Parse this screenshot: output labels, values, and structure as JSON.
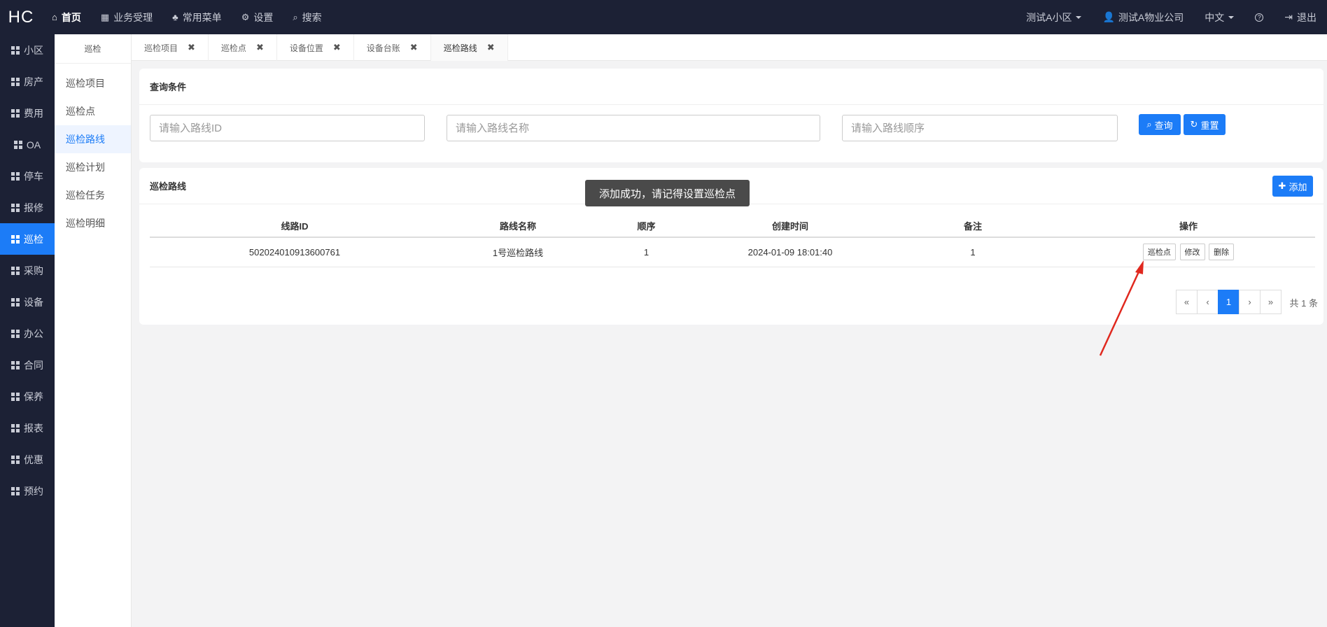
{
  "logo": "HC",
  "topnav": [
    {
      "icon": "home-icon",
      "label": "首页"
    },
    {
      "icon": "table-icon",
      "label": "业务受理"
    },
    {
      "icon": "sitemap-icon",
      "label": "常用菜单"
    },
    {
      "icon": "gear-icon",
      "label": "设置"
    },
    {
      "icon": "search-icon",
      "label": "搜索"
    }
  ],
  "topright": {
    "community": "测试A小区",
    "company": "测试A物业公司",
    "language": "中文",
    "help": "?",
    "logout": "退出"
  },
  "rail": [
    "小区",
    "房产",
    "费用",
    "OA",
    "停车",
    "报修",
    "巡检",
    "采购",
    "设备",
    "办公",
    "合同",
    "保养",
    "报表",
    "优惠",
    "预约"
  ],
  "submenu": {
    "title": "巡检",
    "items": [
      "巡检项目",
      "巡检点",
      "巡检路线",
      "巡检计划",
      "巡检任务",
      "巡检明细"
    ]
  },
  "tabs": [
    "巡检项目",
    "巡检点",
    "设备位置",
    "设备台账",
    "巡检路线"
  ],
  "search": {
    "title": "查询条件",
    "route_id_placeholder": "请输入路线ID",
    "route_name_placeholder": "请输入路线名称",
    "route_order_placeholder": "请输入路线顺序",
    "query_label": "查询",
    "reset_label": "重置"
  },
  "list": {
    "title": "巡检路线",
    "add_label": "添加",
    "headers": [
      "线路ID",
      "路线名称",
      "顺序",
      "创建时间",
      "备注",
      "操作"
    ],
    "rows": [
      {
        "id": "502024010913600761",
        "name": "1号巡检路线",
        "order": "1",
        "created": "2024-01-09 18:01:40",
        "remark": "1"
      }
    ],
    "actions": [
      "巡检点",
      "修改",
      "删除"
    ]
  },
  "pager": {
    "first": "«",
    "prev": "‹",
    "current": "1",
    "next": "›",
    "last": "»",
    "total": "共 1 条"
  },
  "toast": "添加成功，请记得设置巡检点",
  "colors": {
    "accent": "#1c7cf7",
    "nav_bg": "#1c2135",
    "annotation_arrow": "#e0281e"
  }
}
